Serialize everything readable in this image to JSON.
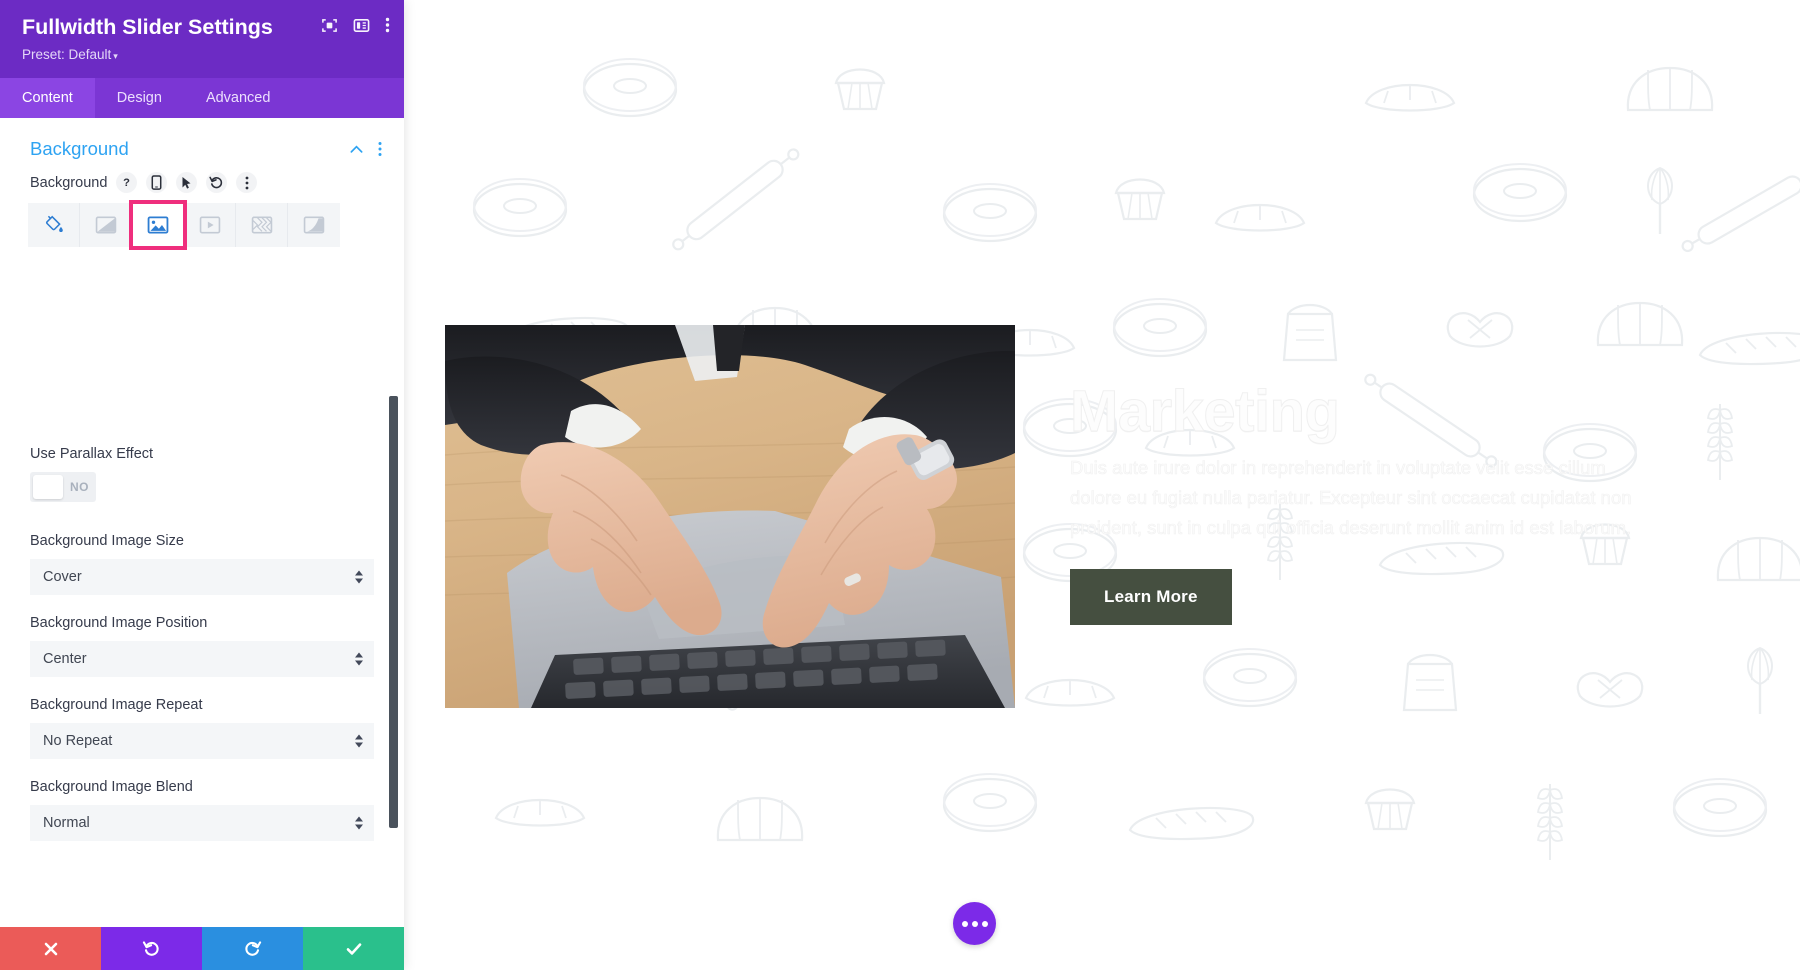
{
  "panel": {
    "title": "Fullwidth Slider Settings",
    "preset_label": "Preset: Default",
    "preset_caret": "▾",
    "header_icons": [
      {
        "name": "focus-target-icon",
        "label": "Focus"
      },
      {
        "name": "layout-panel-icon",
        "label": "Layout"
      },
      {
        "name": "more-vertical-icon",
        "label": "More"
      }
    ],
    "tabs": [
      {
        "label": "Content",
        "active": true
      },
      {
        "label": "Design",
        "active": false
      },
      {
        "label": "Advanced",
        "active": false
      }
    ],
    "section": {
      "title": "Background",
      "collapse_icon": "chevron-up-icon",
      "more_icon": "more-vertical-icon"
    },
    "background_field": {
      "label": "Background",
      "icons": [
        {
          "name": "help-icon",
          "glyph": "?"
        },
        {
          "name": "responsive-mobile-icon",
          "glyph": "mobile"
        },
        {
          "name": "hover-cursor-icon",
          "glyph": "cursor"
        },
        {
          "name": "reset-icon",
          "glyph": "undo"
        },
        {
          "name": "more-vertical-icon",
          "glyph": "dots"
        }
      ],
      "types": [
        {
          "name": "background-color",
          "icon": "paint-bucket-icon",
          "selected": false
        },
        {
          "name": "background-gradient",
          "icon": "gradient-icon",
          "selected": false
        },
        {
          "name": "background-image",
          "icon": "image-icon",
          "selected": true
        },
        {
          "name": "background-video",
          "icon": "video-icon",
          "selected": false
        },
        {
          "name": "background-pattern",
          "icon": "pattern-icon",
          "selected": false
        },
        {
          "name": "background-mask",
          "icon": "mask-icon",
          "selected": false
        }
      ],
      "selected_highlight_color": "#ef2e7d"
    },
    "fields": [
      {
        "key": "parallax",
        "label": "Use Parallax Effect",
        "type": "toggle",
        "value": "NO"
      },
      {
        "key": "image_size",
        "label": "Background Image Size",
        "type": "select",
        "value": "Cover"
      },
      {
        "key": "image_position",
        "label": "Background Image Position",
        "type": "select",
        "value": "Center"
      },
      {
        "key": "image_repeat",
        "label": "Background Image Repeat",
        "type": "select",
        "value": "No Repeat"
      },
      {
        "key": "image_blend",
        "label": "Background Image Blend",
        "type": "select",
        "value": "Normal"
      }
    ],
    "footer": [
      {
        "name": "cancel-button",
        "icon": "close-icon",
        "color": "#eb5b58"
      },
      {
        "name": "undo-button",
        "icon": "undo-icon",
        "color": "#7c2ae8"
      },
      {
        "name": "redo-button",
        "icon": "redo-icon",
        "color": "#2a8fe0"
      },
      {
        "name": "save-button",
        "icon": "check-icon",
        "color": "#2ac08c"
      }
    ],
    "accent_purple": "#6c2bc4",
    "tab_purple": "#7b36d4",
    "link_blue": "#2ea3f2"
  },
  "canvas": {
    "slide": {
      "heading": "Marketing",
      "body": "Duis aute irure dolor in reprehenderit in voluptate velit esse cillum dolore eu fugiat nulla pariatur. Excepteur sint occaecat cupidatat non proident, sunt in culpa qui officia deserunt mollit anim id est laborum.",
      "button_label": "Learn More",
      "button_color": "#454f40",
      "image_alt": "hands-typing-on-laptop"
    },
    "fab": {
      "name": "page-settings-fab",
      "icon": "ellipsis-icon",
      "color": "#7c2ae8"
    },
    "background_pattern": "bakery-line-art-pattern"
  }
}
